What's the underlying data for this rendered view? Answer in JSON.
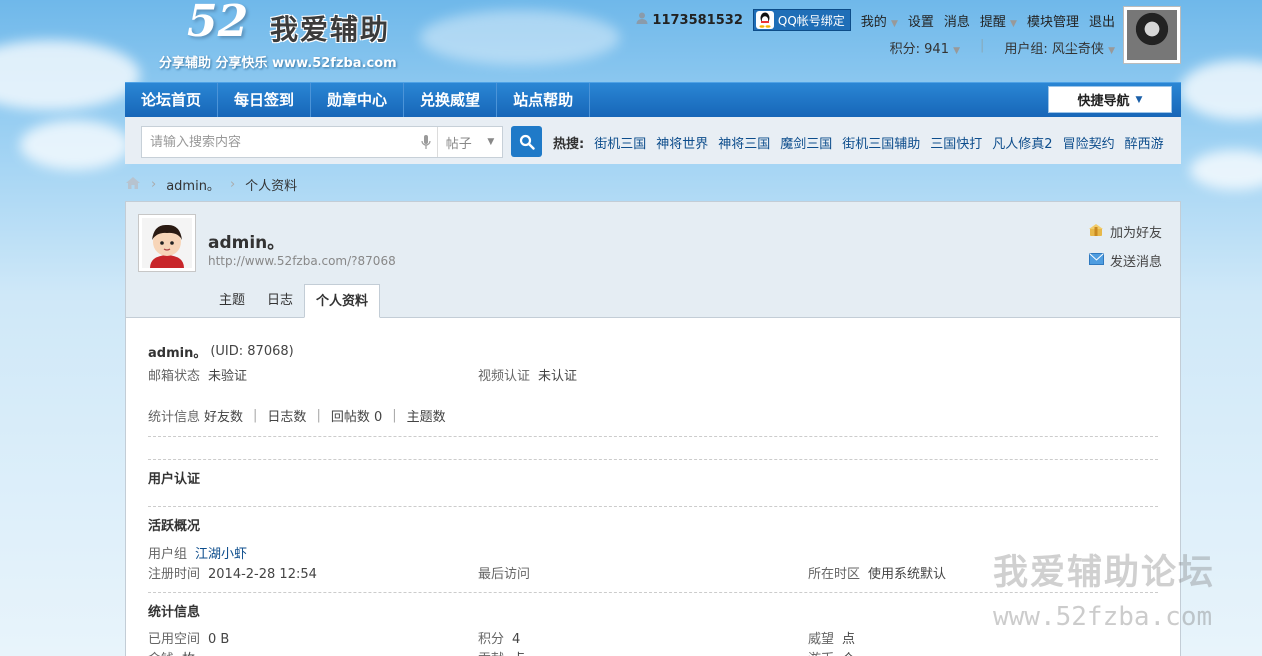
{
  "site": {
    "logo_num": "52",
    "logo_title": "我爱辅助",
    "logo_slogan": "分享辅助  分享快乐  www.52fzba.com"
  },
  "topbar": {
    "user_id": "1173581532",
    "qq_bind": "QQ帐号绑定",
    "my": "我的",
    "settings": "设置",
    "messages": "消息",
    "remind": "提醒",
    "module_manage": "模块管理",
    "logout": "退出",
    "points": "积分: 941",
    "user_group": "用户组: 风尘奇侠"
  },
  "nav": {
    "items": [
      "论坛首页",
      "每日签到",
      "勋章中心",
      "兑换威望",
      "站点帮助"
    ],
    "quick_nav": "快捷导航"
  },
  "search": {
    "placeholder": "请输入搜索内容",
    "type": "帖子",
    "hot_label": "热搜:",
    "hot": [
      "街机三国",
      "神将世界",
      "神将三国",
      "魔剑三国",
      "街机三国辅助",
      "三国快打",
      "凡人修真2",
      "冒险契约",
      "醉西游"
    ]
  },
  "breadcrumb": {
    "user": "admin。",
    "page": "个人资料"
  },
  "profile": {
    "name": "admin。",
    "url": "http://www.52fzba.com/?87068",
    "add_friend": "加为好友",
    "send_msg": "发送消息",
    "tabs": [
      "主题",
      "日志",
      "个人资料"
    ],
    "uid_line": {
      "name": "admin。",
      "uid": "(UID: 87068)"
    },
    "email_label": "邮箱状态",
    "email_value": "未验证",
    "video_label": "视频认证",
    "video_value": "未认证",
    "stats_label": "统计信息",
    "stats": {
      "friends": "好友数",
      "blogs": "日志数",
      "replies": "回帖数",
      "replies_val": "0",
      "threads": "主题数"
    },
    "cert_title": "用户认证",
    "active_title": "活跃概况",
    "group_label": "用户组",
    "group_value": "江湖小虾",
    "reg_label": "注册时间",
    "reg_value": "2014-2-28 12:54",
    "last_visit_label": "最后访问",
    "tz_label": "所在时区",
    "tz_value": "使用系统默认",
    "stat_title": "统计信息",
    "space_label": "已用空间",
    "space_value": "0 B",
    "points_label": "积分",
    "points_value": "4",
    "prestige_label": "威望",
    "prestige_value": "点",
    "money_label": "金钱",
    "money_value": "枚",
    "contrib_label": "贡献",
    "contrib_value": "点",
    "coin_label": "游币",
    "coin_value": "个"
  },
  "watermark": {
    "line1": "我爱辅助论坛",
    "line2": "www.52fzba.com"
  }
}
